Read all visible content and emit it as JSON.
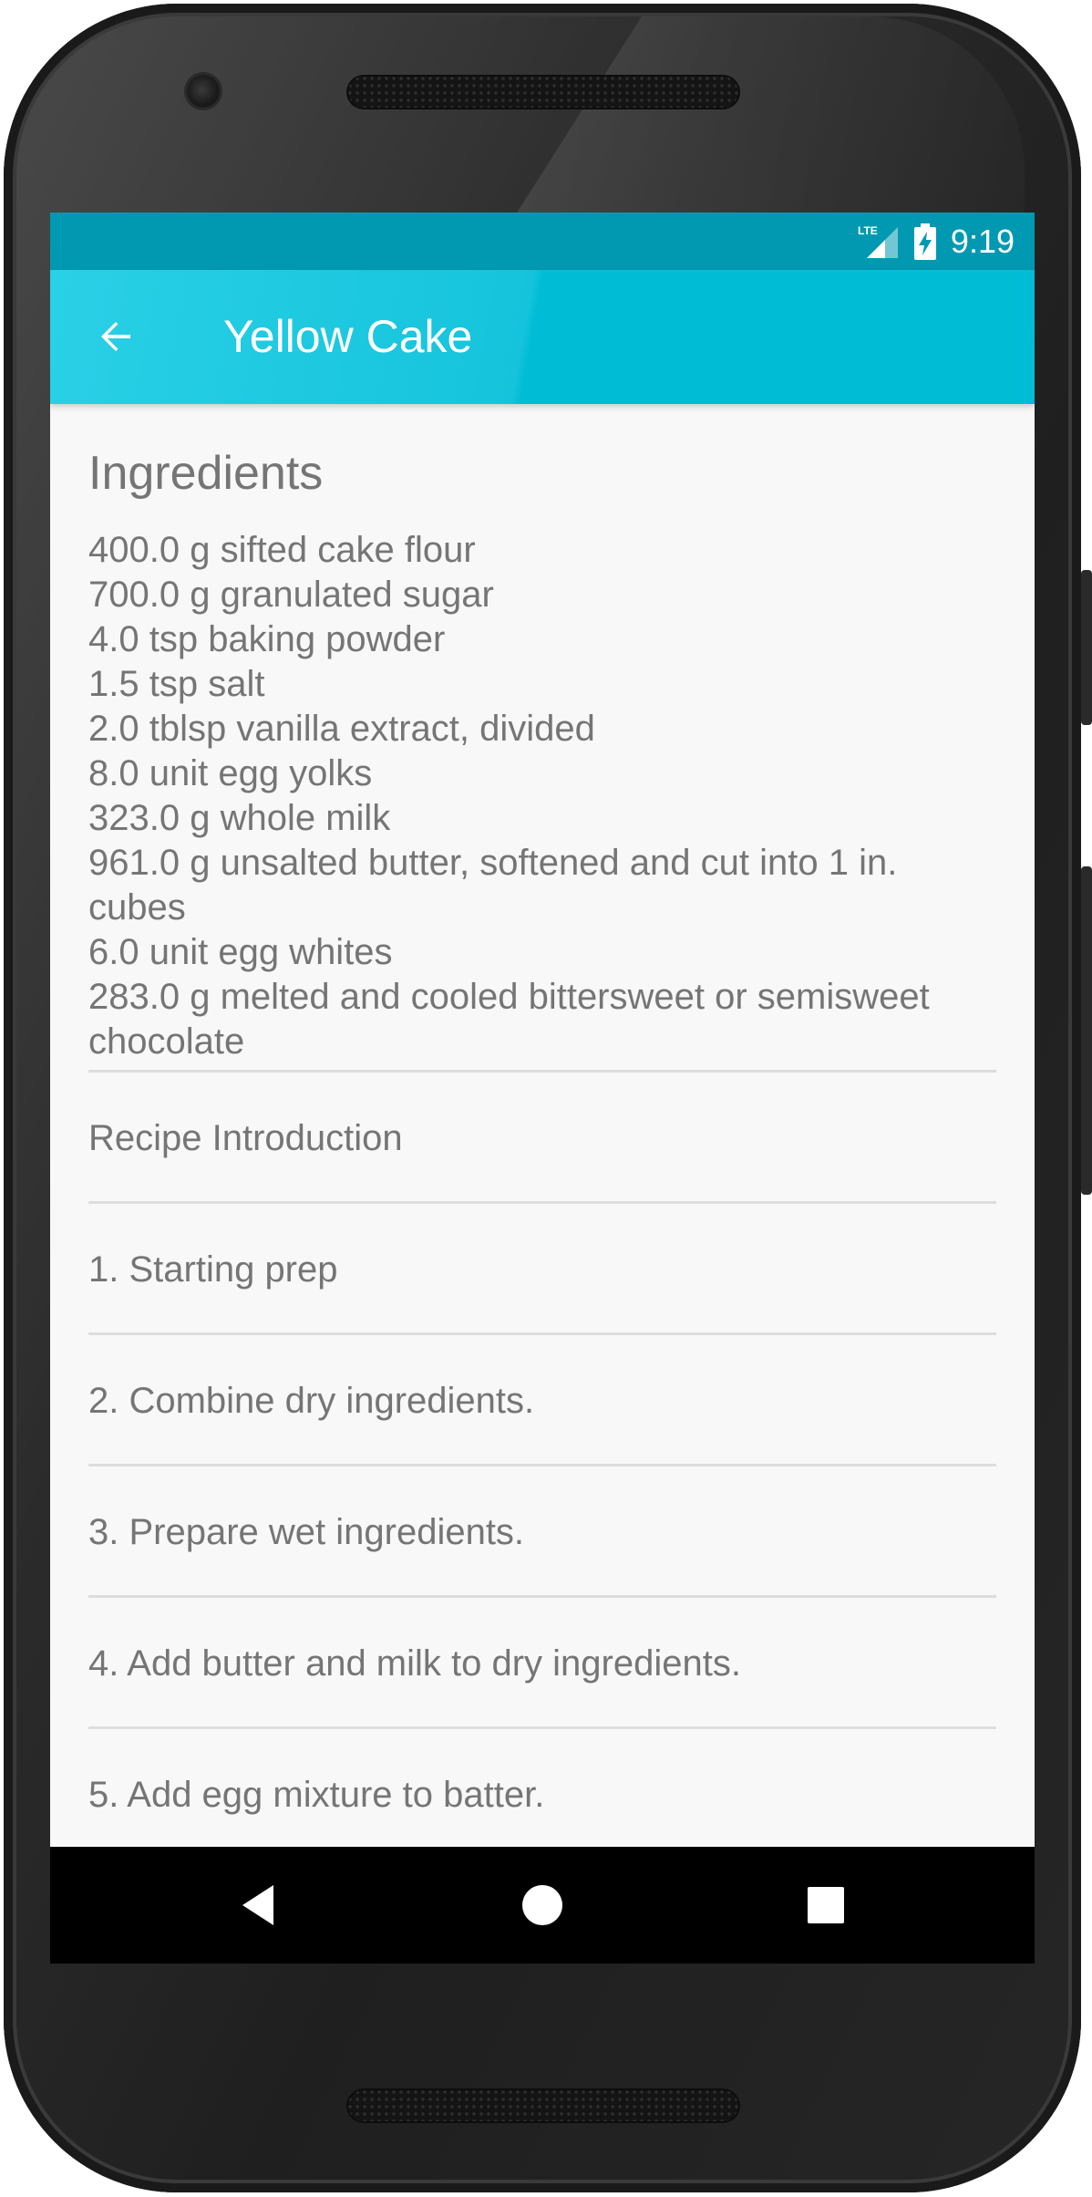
{
  "status_bar": {
    "network_label": "LTE",
    "time": "9:19"
  },
  "app_bar": {
    "back_icon": "arrow-left-icon",
    "title": "Yellow Cake"
  },
  "ingredients": {
    "heading": "Ingredients",
    "items": [
      "400.0 g sifted cake flour",
      "700.0 g granulated sugar",
      "4.0 tsp baking powder",
      "1.5 tsp salt",
      "2.0 tblsp vanilla extract, divided",
      "8.0 unit egg yolks",
      "323.0 g whole milk",
      "961.0 g unsalted butter, softened and cut into 1 in. cubes",
      "6.0 unit egg whites",
      "283.0 g melted and cooled bittersweet or semisweet chocolate"
    ]
  },
  "sections": [
    "Recipe Introduction",
    "1. Starting prep",
    "2. Combine dry ingredients.",
    "3. Prepare wet ingredients.",
    "4. Add butter and milk to dry ingredients.",
    "5. Add egg mixture to batter."
  ],
  "nav_bar": {
    "back_icon": "triangle-back-icon",
    "home_icon": "circle-home-icon",
    "recents_icon": "square-recents-icon"
  },
  "colors": {
    "status_bar": "#0099b1",
    "app_bar": "#00bcd4",
    "content_bg": "#f8f8f8",
    "text": "#757575"
  }
}
